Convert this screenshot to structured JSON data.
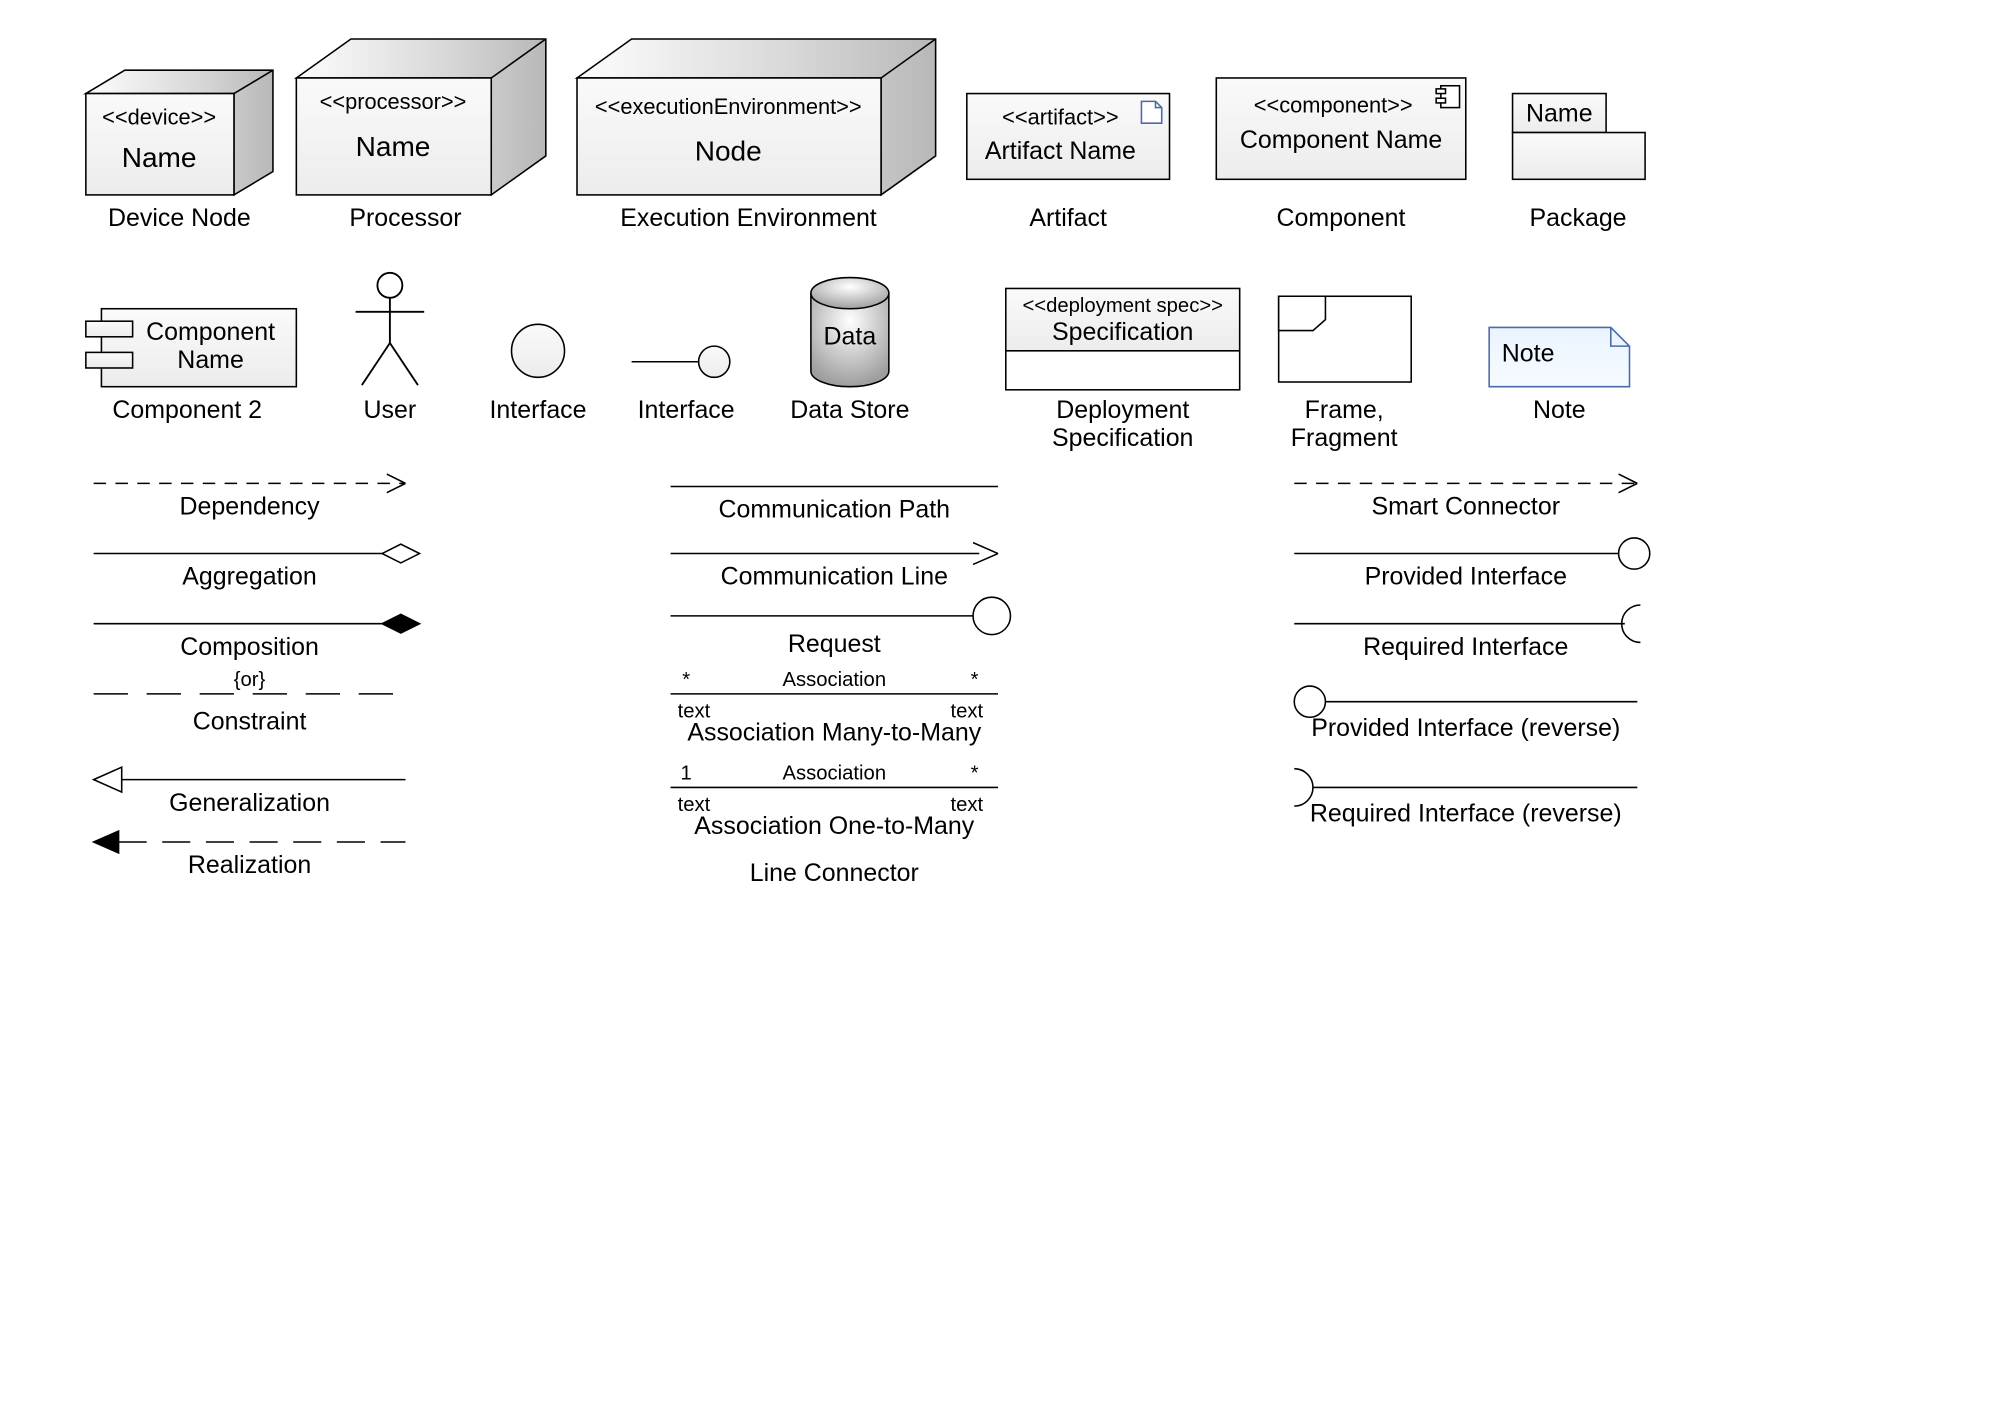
{
  "row1": {
    "device": {
      "stereo": "<<device>>",
      "name": "Name",
      "caption": "Device Node"
    },
    "processor": {
      "stereo": "<<processor>>",
      "name": "Name",
      "caption": "Processor"
    },
    "exec": {
      "stereo": "<<executionEnvironment>>",
      "name": "Node",
      "caption": "Execution Environment"
    },
    "artifact": {
      "stereo": "<<artifact>>",
      "name": "Artifact Name",
      "caption": "Artifact"
    },
    "component": {
      "stereo": "<<component>>",
      "name": "Component Name",
      "caption": "Component"
    },
    "package": {
      "name": "Name",
      "caption": "Package"
    }
  },
  "row2": {
    "component2": {
      "name": "Component\nName",
      "caption": "Component 2"
    },
    "user": {
      "caption": "User"
    },
    "interface1": {
      "caption": "Interface"
    },
    "interface2": {
      "caption": "Interface"
    },
    "datastore": {
      "name": "Data",
      "caption": "Data Store"
    },
    "depspec": {
      "stereo": "<<deployment spec>>",
      "name": "Specification",
      "caption": "Deployment\nSpecification"
    },
    "frame": {
      "caption": "Frame,\nFragment"
    },
    "note": {
      "name": "Note",
      "caption": "Note"
    }
  },
  "connectors": {
    "col1": {
      "dependency": "Dependency",
      "aggregation": "Aggregation",
      "composition": "Composition",
      "constraint": {
        "text": "{or}",
        "caption": "Constraint"
      },
      "generalization": "Generalization",
      "realization": "Realization"
    },
    "col2": {
      "commPath": "Communication Path",
      "commLine": "Communication Line",
      "request": "Request",
      "assocMM": {
        "left": "*",
        "mid": "Association",
        "right": "*",
        "tl": "text",
        "tr": "text",
        "caption": "Association Many-to-Many"
      },
      "assocOM": {
        "left": "1",
        "mid": "Association",
        "right": "*",
        "tl": "text",
        "tr": "text",
        "caption": "Association One-to-Many"
      },
      "lineConn": "Line Connector"
    },
    "col3": {
      "smart": "Smart Connector",
      "provided": "Provided Interface",
      "required": "Required Interface",
      "providedRev": "Provided Interface (reverse)",
      "requiredRev": "Required Interface (reverse)"
    }
  }
}
